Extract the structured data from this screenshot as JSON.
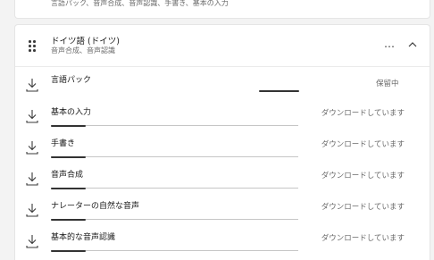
{
  "prev_card": {
    "subtitle": "言語パック、音声合成、音声認識、手書き、基本の入力"
  },
  "language": {
    "title": "ドイツ語 (ドイツ)",
    "subtitle": "音声合成、音声認識",
    "more_label": "…"
  },
  "pack_row": {
    "label": "言語パック",
    "status": "保留中"
  },
  "features": [
    {
      "label": "基本の入力",
      "status": "ダウンロードしています",
      "progress": 0.14
    },
    {
      "label": "手書き",
      "status": "ダウンロードしています",
      "progress": 0.14
    },
    {
      "label": "音声合成",
      "status": "ダウンロードしています",
      "progress": 0.14
    },
    {
      "label": "ナレーターの自然な音声",
      "status": "ダウンロードしています",
      "progress": 0.14
    },
    {
      "label": "基本的な音声認識",
      "status": "ダウンロードしています",
      "progress": 0.14
    }
  ],
  "icons": {
    "download": "download-icon",
    "grip": "drag-handle-icon",
    "more": "more-icon",
    "collapse": "chevron-up-icon"
  },
  "colors": {
    "progress_fill": "#333333",
    "track": "#c6c6c6"
  }
}
